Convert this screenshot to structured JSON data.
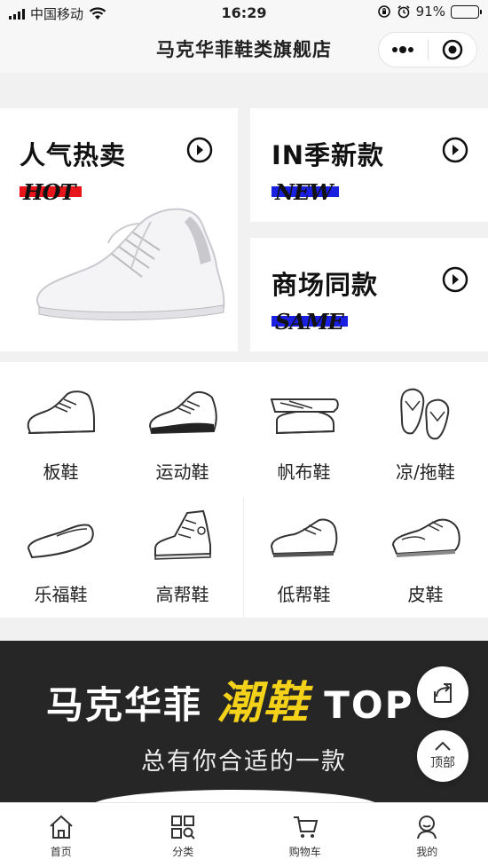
{
  "status_bar": {
    "carrier": "中国移动",
    "time": "16:29",
    "battery_percent": "91%",
    "battery_level": 0.91,
    "icons": [
      "signal-icon",
      "wifi-icon",
      "orientation-lock-icon",
      "alarm-icon",
      "battery-icon"
    ]
  },
  "nav": {
    "title": "马克华菲鞋类旗舰店",
    "icons": [
      "more-dots-icon",
      "close-target-icon"
    ]
  },
  "promos": [
    {
      "title": "人气热卖",
      "tag": "HOT",
      "tag_color": "#e8151b"
    },
    {
      "title": "IN季新款",
      "tag": "NEW",
      "tag_color": "#1a1fe0"
    },
    {
      "title": "商场同款",
      "tag": "SAME",
      "tag_color": "#1a1fe0"
    }
  ],
  "categories": [
    {
      "label": "板鞋",
      "icon": "skate-shoe-icon"
    },
    {
      "label": "运动鞋",
      "icon": "sport-shoe-icon"
    },
    {
      "label": "帆布鞋",
      "icon": "canvas-shoe-icon"
    },
    {
      "label": "凉/拖鞋",
      "icon": "slipper-icon"
    },
    {
      "label": "乐福鞋",
      "icon": "loafer-icon"
    },
    {
      "label": "高帮鞋",
      "icon": "high-top-icon"
    },
    {
      "label": "低帮鞋",
      "icon": "low-top-icon"
    },
    {
      "label": "皮鞋",
      "icon": "leather-shoe-icon"
    }
  ],
  "banner": {
    "title_prefix": "马克华菲",
    "title_accent": "潮鞋",
    "title_suffix": "TOP",
    "subtitle": "总有你合适的一款",
    "accent_color": "#f5d21a"
  },
  "floating": {
    "share_icon": "share-icon",
    "top_label": "顶部"
  },
  "tabs": [
    {
      "label": "首页",
      "icon": "home-icon"
    },
    {
      "label": "分类",
      "icon": "grid-icon"
    },
    {
      "label": "购物车",
      "icon": "cart-icon"
    },
    {
      "label": "我的",
      "icon": "user-icon"
    }
  ]
}
